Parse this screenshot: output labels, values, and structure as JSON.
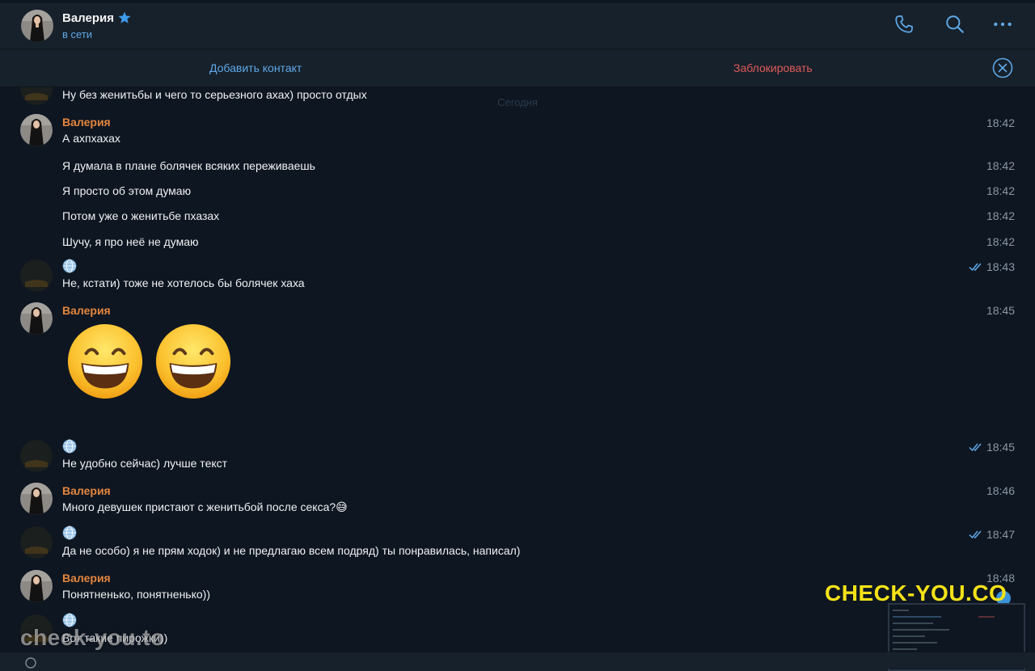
{
  "header": {
    "name": "Валерия",
    "status": "в сети"
  },
  "action_bar": {
    "add_contact": "Добавить контакт",
    "block": "Заблокировать"
  },
  "chat": {
    "date_separator": "Сегодня",
    "messages": [
      {
        "text": "Ну без женитьбы и чего то серьезного ахах) просто отдых"
      },
      {
        "sender": "Валерия",
        "text": "А ахпхахах",
        "time": "18:42"
      },
      {
        "text": "Я думала в плане болячек всяких переживаешь",
        "time": "18:42"
      },
      {
        "text": "Я просто об этом думаю",
        "time": "18:42"
      },
      {
        "text": "Потом уже о женитьбе пхазах",
        "time": "18:42"
      },
      {
        "text": "Шучу, я про неё не думаю",
        "time": "18:42"
      },
      {
        "text": "Не, кстати) тоже не хотелось бы болячек хаха",
        "time": "18:43",
        "read": true
      },
      {
        "sender": "Валерия",
        "text": "😄😄",
        "time": "18:45"
      },
      {
        "text": "Не удобно сейчас) лучше текст",
        "time": "18:45",
        "read": true
      },
      {
        "sender": "Валерия",
        "text": "Много девушек пристают с женитьбой после секса?😅",
        "time": "18:46"
      },
      {
        "text": "Да не особо) я не прям ходок) и не предлагаю всем подряд) ты понравилась, написал)",
        "time": "18:47",
        "read": true
      },
      {
        "sender": "Валерия",
        "text": "Понятненько, понятненько))",
        "time": "18:48"
      },
      {
        "text": "Вот такие пирожки))"
      }
    ]
  },
  "watermarks": {
    "left": "check-you.to",
    "right": "CHECK-YOU.CO"
  },
  "colors": {
    "background": "#0e1621",
    "panel": "#17212b",
    "accent": "#5fa8e8",
    "sender": "#e4853d",
    "danger": "#e05a5a"
  }
}
